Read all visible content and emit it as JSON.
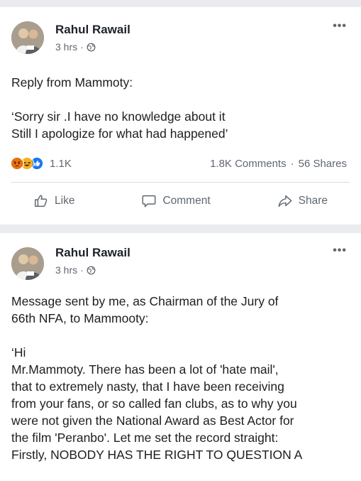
{
  "post1": {
    "author": "Rahul Rawail",
    "time": "3 hrs",
    "separator": "·",
    "more": "•••",
    "lines": [
      "Reply from Mammoty:",
      "‘Sorry sir .I have no knowledge about it",
      "Still I apologize for what had happened’"
    ],
    "reactions_count": "1.1K",
    "comments": "1.8K Comments",
    "stats_sep": "·",
    "shares": "56 Shares",
    "actions": {
      "like": "Like",
      "comment": "Comment",
      "share": "Share"
    }
  },
  "post2": {
    "author": "Rahul Rawail",
    "time": "3 hrs",
    "separator": "·",
    "more": "•••",
    "lines": [
      "Message sent by me, as Chairman of the Jury of",
      "66th NFA, to Mammooty:",
      "‘Hi",
      "Mr.Mammoty. There has been a lot of 'hate mail',",
      "that to extremely nasty, that I have been receiving",
      "from your fans, or so called fan clubs, as to why you",
      "were not given the National Award as Best Actor for",
      "the film 'Peranbo'.  Let me set the record straight:",
      "Firstly, NOBODY HAS THE RIGHT TO QUESTION A"
    ]
  },
  "icons": [
    "globe-icon",
    "more-icon",
    "angry-react-icon",
    "haha-react-icon",
    "like-react-icon",
    "like-icon",
    "comment-icon",
    "share-icon"
  ],
  "colors": {
    "background": "#e9ebee",
    "card": "#ffffff",
    "text": "#1c1e21",
    "muted": "#606770",
    "like_blue": "#1877f2",
    "angry": "#e9710f",
    "haha": "#f7b125"
  }
}
